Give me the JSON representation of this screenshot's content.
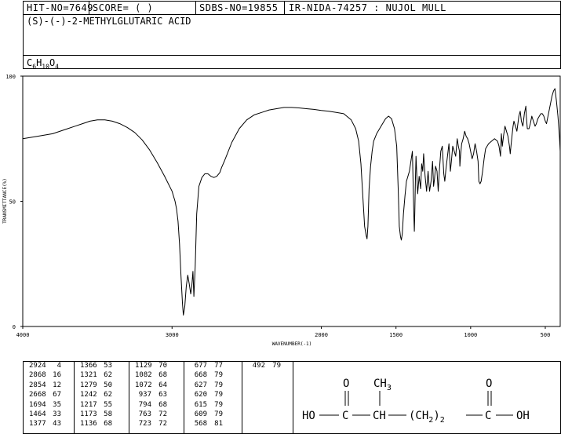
{
  "header": {
    "hit_no": "HIT-NO=7649",
    "score": "SCORE=  (   )",
    "sdbs_no": "SDBS-NO=19855",
    "ir_info": "IR-NIDA-74257 : NUJOL MULL"
  },
  "compound": {
    "name": "(S)-(-)-2-METHYLGLUTARIC ACID",
    "formula": {
      "c": "C",
      "c_n": "6",
      "h": "H",
      "h_n": "10",
      "o": "O",
      "o_n": "4"
    }
  },
  "chart_data": {
    "type": "line",
    "xlabel": "WAVENUMBER(-1)",
    "ylabel": "TRANSMITTANCE(%)",
    "xlim": [
      4000,
      400
    ],
    "ylim": [
      0,
      100
    ],
    "x_ticks": [
      4000,
      3000,
      2000,
      1500,
      1000,
      500
    ],
    "y_ticks": [
      0,
      50,
      100
    ],
    "grid": false,
    "series": [
      {
        "x": [
          4000,
          3900,
          3800,
          3700,
          3650,
          3600,
          3550,
          3500,
          3450,
          3400,
          3350,
          3300,
          3250,
          3200,
          3150,
          3100,
          3050,
          3000,
          2990,
          2980,
          2970,
          2960,
          2950,
          2940,
          2930,
          2924,
          2915,
          2905,
          2895,
          2885,
          2875,
          2868,
          2860,
          2854,
          2845,
          2835,
          2820,
          2800,
          2780,
          2760,
          2740,
          2720,
          2700,
          2680,
          2668,
          2650,
          2630,
          2600,
          2550,
          2500,
          2450,
          2400,
          2350,
          2300,
          2250,
          2200,
          2150,
          2100,
          2050,
          2000,
          1950,
          1900,
          1850,
          1800,
          1770,
          1750,
          1735,
          1720,
          1710,
          1700,
          1694,
          1688,
          1680,
          1670,
          1660,
          1650,
          1630,
          1600,
          1570,
          1550,
          1530,
          1510,
          1495,
          1485,
          1478,
          1470,
          1464,
          1458,
          1450,
          1440,
          1430,
          1420,
          1410,
          1400,
          1390,
          1385,
          1380,
          1377,
          1374,
          1370,
          1366,
          1362,
          1355,
          1345,
          1335,
          1328,
          1321,
          1315,
          1305,
          1295,
          1285,
          1279,
          1275,
          1265,
          1255,
          1248,
          1242,
          1235,
          1225,
          1217,
          1210,
          1200,
          1190,
          1180,
          1173,
          1165,
          1155,
          1145,
          1136,
          1129,
          1120,
          1110,
          1100,
          1090,
          1082,
          1075,
          1072,
          1068,
          1060,
          1050,
          1040,
          1030,
          1020,
          1010,
          1000,
          990,
          980,
          970,
          960,
          950,
          945,
          937,
          930,
          920,
          910,
          900,
          880,
          860,
          840,
          820,
          810,
          800,
          794,
          788,
          780,
          770,
          760,
          750,
          740,
          735,
          730,
          723,
          716,
          710,
          700,
          690,
          677,
          668,
          660,
          650,
          640,
          630,
          627,
          620,
          615,
          609,
          600,
          590,
          580,
          568,
          560,
          550,
          540,
          530,
          520,
          510,
          500,
          492,
          485,
          475,
          465,
          455,
          445,
          435,
          425,
          415,
          405,
          400
        ],
        "y": [
          75,
          76,
          77,
          79,
          80,
          81,
          82,
          82.5,
          82.5,
          82,
          81,
          79.5,
          77.5,
          74.5,
          70.5,
          65.5,
          60,
          54,
          52,
          50,
          47,
          42,
          33,
          20,
          9,
          4.5,
          8,
          16,
          20.5,
          17,
          13,
          16,
          22,
          12,
          24,
          45,
          56,
          59.5,
          61,
          61,
          60,
          59.5,
          60,
          61.5,
          63.5,
          66,
          69,
          73.5,
          79,
          82.5,
          84.5,
          85.5,
          86.5,
          87,
          87.5,
          87.5,
          87.3,
          87,
          86.7,
          86.3,
          86,
          85.5,
          85,
          82.5,
          79,
          74,
          65,
          50,
          40,
          36.5,
          35,
          40,
          55,
          64,
          70,
          74,
          77,
          80,
          83,
          84,
          83,
          79,
          72,
          55,
          40,
          36,
          34.5,
          37,
          45,
          52,
          58,
          60,
          62,
          66,
          70,
          56,
          44,
          38,
          46,
          58,
          68,
          62,
          53,
          60,
          55,
          65,
          62,
          69,
          60,
          54,
          62,
          57,
          54,
          58,
          66,
          56,
          59,
          64,
          62,
          54,
          62,
          70,
          72,
          61,
          58,
          63,
          68,
          73,
          62,
          66,
          72,
          70,
          68,
          75,
          72,
          70,
          64,
          68,
          73,
          75,
          78,
          76,
          75,
          73,
          70,
          67,
          69,
          73,
          70,
          66,
          58,
          57,
          58,
          62,
          67,
          71,
          73,
          74,
          75,
          74,
          72,
          68,
          77,
          72,
          76,
          80,
          78,
          76,
          72,
          69,
          72,
          76,
          80,
          82,
          80,
          78,
          84,
          86,
          82,
          80,
          85,
          88,
          84,
          79,
          79,
          79,
          81,
          84,
          82,
          80,
          81,
          83,
          84,
          85,
          85,
          84,
          82,
          81,
          83,
          86,
          89,
          92,
          94,
          95,
          90,
          84,
          76,
          70
        ]
      }
    ],
    "peaks": [
      {
        "wavenumber": "2924",
        "intensity": "4"
      },
      {
        "wavenumber": "2868",
        "intensity": "16"
      },
      {
        "wavenumber": "2854",
        "intensity": "12"
      },
      {
        "wavenumber": "2668",
        "intensity": "67"
      },
      {
        "wavenumber": "1694",
        "intensity": "35"
      },
      {
        "wavenumber": "1464",
        "intensity": "33"
      },
      {
        "wavenumber": "1377",
        "intensity": "43"
      },
      {
        "wavenumber": "1366",
        "intensity": "53"
      },
      {
        "wavenumber": "1321",
        "intensity": "62"
      },
      {
        "wavenumber": "1279",
        "intensity": "50"
      },
      {
        "wavenumber": "1242",
        "intensity": "62"
      },
      {
        "wavenumber": "1217",
        "intensity": "55"
      },
      {
        "wavenumber": "1173",
        "intensity": "58"
      },
      {
        "wavenumber": "1136",
        "intensity": "68"
      },
      {
        "wavenumber": "1129",
        "intensity": "70"
      },
      {
        "wavenumber": "1082",
        "intensity": "68"
      },
      {
        "wavenumber": "1072",
        "intensity": "64"
      },
      {
        "wavenumber": "937",
        "intensity": "63"
      },
      {
        "wavenumber": "794",
        "intensity": "68"
      },
      {
        "wavenumber": "763",
        "intensity": "72"
      },
      {
        "wavenumber": "723",
        "intensity": "72"
      },
      {
        "wavenumber": "677",
        "intensity": "77"
      },
      {
        "wavenumber": "668",
        "intensity": "79"
      },
      {
        "wavenumber": "627",
        "intensity": "79"
      },
      {
        "wavenumber": "620",
        "intensity": "79"
      },
      {
        "wavenumber": "615",
        "intensity": "79"
      },
      {
        "wavenumber": "609",
        "intensity": "79"
      },
      {
        "wavenumber": "568",
        "intensity": "81"
      },
      {
        "wavenumber": "492",
        "intensity": "79"
      }
    ]
  },
  "structure": {
    "o_left": "O",
    "o_right": "O",
    "ch3": "CH",
    "ch3_sub": "3",
    "ho": "HO",
    "c1": "C",
    "ch": "CH",
    "ch2_open": "(CH",
    "ch2_sub": "2",
    "ch2_close": ")",
    "ch2_count": "2",
    "c2": "C",
    "oh": "OH"
  }
}
